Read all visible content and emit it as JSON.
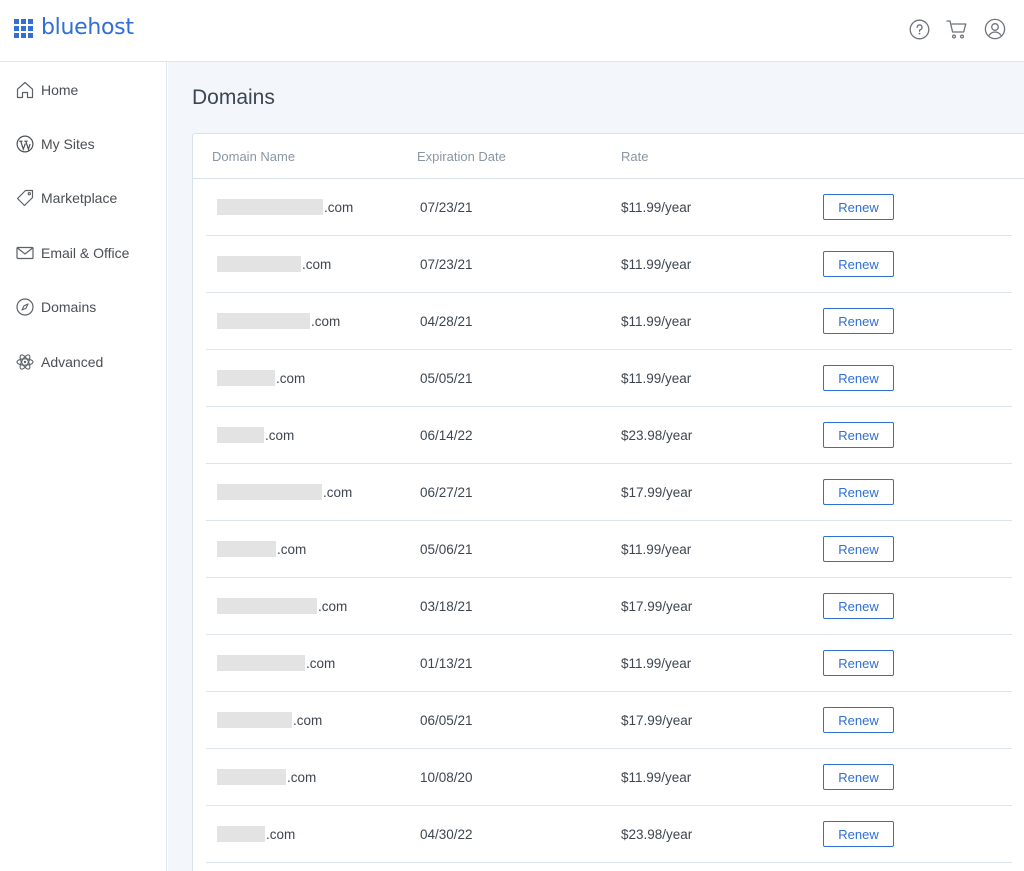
{
  "header": {
    "logo_text": "bluehost",
    "icons": [
      "help-icon",
      "cart-icon",
      "account-icon"
    ]
  },
  "sidebar": {
    "items": [
      {
        "label": "Home",
        "icon": "home-icon"
      },
      {
        "label": "My Sites",
        "icon": "wordpress-icon"
      },
      {
        "label": "Marketplace",
        "icon": "tag-icon"
      },
      {
        "label": "Email & Office",
        "icon": "mail-icon"
      },
      {
        "label": "Domains",
        "icon": "compass-icon"
      },
      {
        "label": "Advanced",
        "icon": "atom-icon"
      }
    ]
  },
  "main": {
    "title": "Domains",
    "columns": [
      "Domain Name",
      "Expiration Date",
      "Rate"
    ],
    "renew_label": "Renew",
    "rows": [
      {
        "suffix": ".com",
        "expiration": "07/23/21",
        "rate": "$11.99/year"
      },
      {
        "suffix": ".com",
        "expiration": "07/23/21",
        "rate": "$11.99/year"
      },
      {
        "suffix": ".com",
        "expiration": "04/28/21",
        "rate": "$11.99/year"
      },
      {
        "suffix": ".com",
        "expiration": "05/05/21",
        "rate": "$11.99/year"
      },
      {
        "suffix": ".com",
        "expiration": "06/14/22",
        "rate": "$23.98/year"
      },
      {
        "suffix": ".com",
        "expiration": "06/27/21",
        "rate": "$17.99/year"
      },
      {
        "suffix": ".com",
        "expiration": "05/06/21",
        "rate": "$11.99/year"
      },
      {
        "suffix": ".com",
        "expiration": "03/18/21",
        "rate": "$17.99/year"
      },
      {
        "suffix": ".com",
        "expiration": "01/13/21",
        "rate": "$11.99/year"
      },
      {
        "suffix": ".com",
        "expiration": "06/05/21",
        "rate": "$17.99/year"
      },
      {
        "suffix": ".com",
        "expiration": "10/08/20",
        "rate": "$11.99/year"
      },
      {
        "suffix": ".com",
        "expiration": "04/30/22",
        "rate": "$23.98/year"
      }
    ]
  },
  "colors": {
    "brand": "#2f6fd6",
    "background": "#f3f7fb",
    "redaction": "#e3e3e3"
  }
}
